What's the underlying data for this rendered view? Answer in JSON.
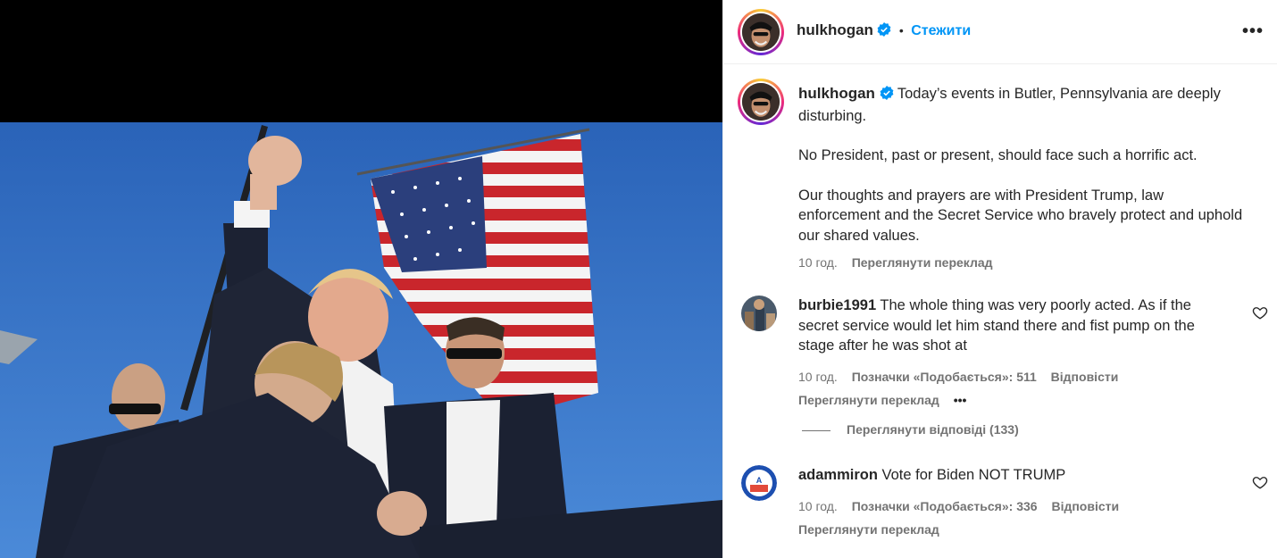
{
  "post": {
    "username": "hulkhogan",
    "follow_label": "Стежити",
    "more_label": "•••",
    "caption_username": "hulkhogan",
    "caption_p1": "Today’s events in Butler, Pennsylvania are deeply disturbing.",
    "caption_p2": "No President, past or present, should face such a horrific act.",
    "caption_p3": "Our thoughts and prayers are with President Trump, law enforcement and the Secret Service who bravely protect and uphold our shared values.",
    "time": "10 год.",
    "see_translation": "Переглянути переклад"
  },
  "comments": [
    {
      "username": "burbie1991",
      "text": "The whole thing was very poorly acted. As if the secret service would let him stand there and fist pump on the stage after he was shot at",
      "time": "10 год.",
      "likes": "Позначки «Подобається»: 511",
      "reply": "Відповісти",
      "see_translation": "Переглянути переклад",
      "more": "•••",
      "view_replies": "Переглянути відповіді (133)"
    },
    {
      "username": "adammiron",
      "text": "Vote for Biden NOT TRUMP",
      "time": "10 год.",
      "likes": "Позначки «Подобається»: 336",
      "reply": "Відповісти",
      "see_translation": "Переглянути переклад"
    }
  ],
  "colors": {
    "accent": "#0095f6",
    "verified": "#0095f6",
    "muted": "#737373",
    "sky": "#2f6ec5"
  },
  "icons": {
    "verified": "verified-badge-icon",
    "heart": "heart-outline-icon",
    "more": "more-horizontal-icon"
  }
}
